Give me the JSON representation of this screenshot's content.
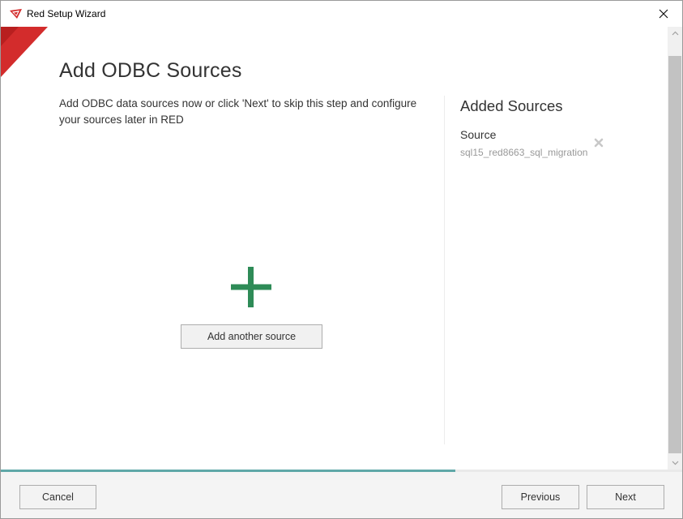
{
  "window": {
    "title": "Red Setup Wizard",
    "icon": "red-logo-icon",
    "close_icon": "close-icon"
  },
  "page": {
    "heading": "Add ODBC Sources",
    "description": "Add ODBC data sources now or click 'Next' to skip this step and configure your sources later in RED",
    "add_button_label": "Add another source",
    "add_icon": "plus-icon"
  },
  "added_sources": {
    "title": "Added Sources",
    "items": [
      {
        "label": "Source",
        "value": "sql15_red8663_sql_migration",
        "remove_icon": "remove-icon"
      }
    ]
  },
  "progress": {
    "fraction": 0.667
  },
  "footer": {
    "cancel_label": "Cancel",
    "previous_label": "Previous",
    "next_label": "Next"
  },
  "colors": {
    "accent_red": "#d32c2c",
    "plus_green": "#2e8b57",
    "progress": "#5fa8a8"
  }
}
